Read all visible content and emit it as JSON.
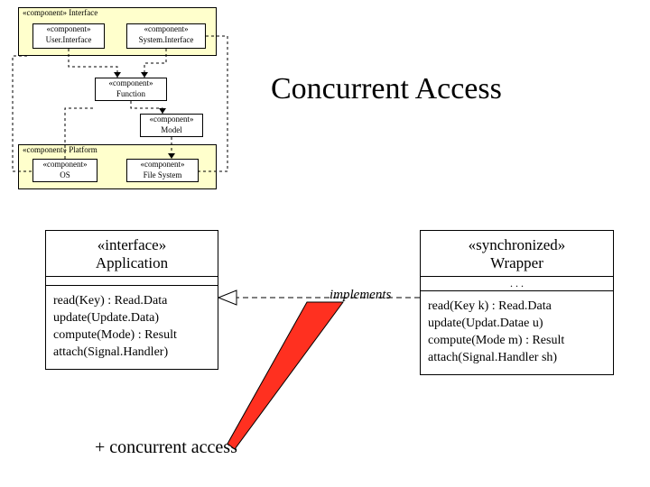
{
  "title": "Concurrent Access",
  "components": {
    "interface_outer": "«component» Interface",
    "user_iface": {
      "stereo": "«component»",
      "name": "User.Interface"
    },
    "system_iface": {
      "stereo": "«component»",
      "name": "System.Interface"
    },
    "function": {
      "stereo": "«component»",
      "name": "Function"
    },
    "model": {
      "stereo": "«component»",
      "name": "Model"
    },
    "platform_outer": "«component» Platform",
    "os": {
      "stereo": "«component»",
      "name": "OS"
    },
    "filesystem": {
      "stereo": "«component»",
      "name": "File System"
    }
  },
  "interface_box": {
    "stereo": "«interface»",
    "name": "Application",
    "ops": [
      "read(Key) : Read.Data",
      "update(Update.Data)",
      "compute(Mode) : Result",
      "attach(Signal.Handler)"
    ]
  },
  "wrapper_box": {
    "stereo": "«synchronized»",
    "name": "Wrapper",
    "mid": ". . .",
    "ops": [
      "read(Key k) : Read.Data",
      "update(Updat.Datae u)",
      "compute(Mode m) : Result",
      "attach(Signal.Handler sh)"
    ]
  },
  "labels": {
    "implements": "implements",
    "concurrent": "+  concurrent access"
  }
}
